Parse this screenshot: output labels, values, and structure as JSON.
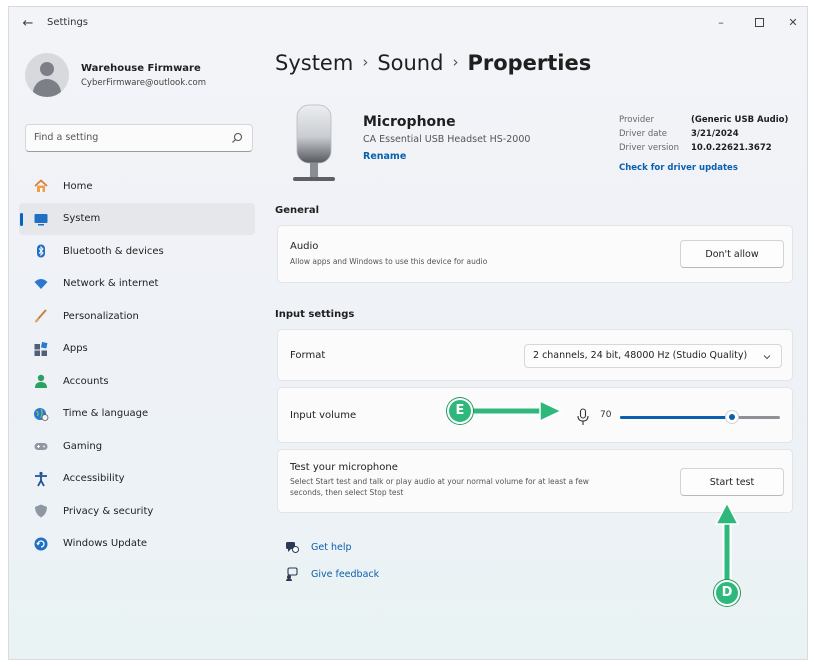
{
  "window": {
    "title": "Settings",
    "back_glyph": "←",
    "min_glyph": "–",
    "close_glyph": "✕"
  },
  "profile": {
    "name": "Warehouse Firmware",
    "email": "CyberFirmware@outlook.com"
  },
  "search": {
    "placeholder": "Find a setting"
  },
  "sidebar": {
    "items": [
      {
        "label": "Home",
        "icon": "home-icon",
        "active": false
      },
      {
        "label": "System",
        "icon": "system-icon",
        "active": true
      },
      {
        "label": "Bluetooth & devices",
        "icon": "bluetooth-icon",
        "active": false
      },
      {
        "label": "Network & internet",
        "icon": "wifi-icon",
        "active": false
      },
      {
        "label": "Personalization",
        "icon": "brush-icon",
        "active": false
      },
      {
        "label": "Apps",
        "icon": "apps-icon",
        "active": false
      },
      {
        "label": "Accounts",
        "icon": "accounts-icon",
        "active": false
      },
      {
        "label": "Time & language",
        "icon": "globe-clock-icon",
        "active": false
      },
      {
        "label": "Gaming",
        "icon": "gamepad-icon",
        "active": false
      },
      {
        "label": "Accessibility",
        "icon": "accessibility-icon",
        "active": false
      },
      {
        "label": "Privacy & security",
        "icon": "shield-icon",
        "active": false
      },
      {
        "label": "Windows Update",
        "icon": "update-icon",
        "active": false
      }
    ]
  },
  "breadcrumb": {
    "items": [
      "System",
      "Sound",
      "Properties"
    ],
    "separator": "›"
  },
  "device": {
    "name": "Microphone",
    "model": "CA Essential USB Headset HS-2000",
    "rename_label": "Rename",
    "properties": [
      {
        "key": "Provider",
        "value": "(Generic USB Audio)"
      },
      {
        "key": "Driver date",
        "value": "3/21/2024"
      },
      {
        "key": "Driver version",
        "value": "10.0.22621.3672"
      }
    ],
    "driver_link": "Check for driver updates"
  },
  "general": {
    "title": "General",
    "audio": {
      "title": "Audio",
      "description": "Allow apps and Windows to use this device for audio",
      "button_label": "Don't allow"
    }
  },
  "input_settings": {
    "title": "Input settings",
    "format": {
      "label": "Format",
      "value": "2 channels, 24 bit, 48000 Hz (Studio Quality)"
    },
    "input_volume": {
      "label": "Input volume",
      "value": "70",
      "level": 0.7
    },
    "test": {
      "title": "Test your microphone",
      "description_line1": "Select Start test and talk or play audio at your normal volume for at least a few",
      "description_line2": "seconds, then select Stop test",
      "button_label": "Start test"
    }
  },
  "help": {
    "get_help": "Get help",
    "give_feedback": "Give feedback"
  },
  "annotations": {
    "e_label": "E",
    "d_label": "D",
    "color": "#2fb87c"
  },
  "colors": {
    "accent": "#0067c0",
    "link": "#0a5fae"
  }
}
